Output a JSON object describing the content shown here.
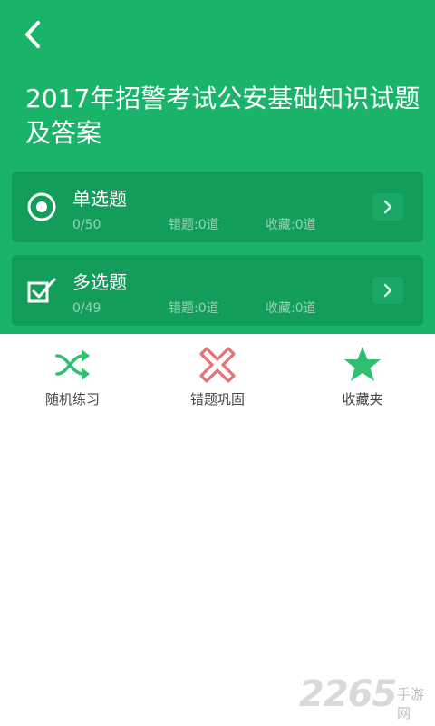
{
  "colors": {
    "header": "#19b36a",
    "card": "#139d5b",
    "accent": "#2fbf71",
    "wrong": "#e57373"
  },
  "header": {
    "title": "2017年招警考试公安基础知识试题及答案",
    "back_icon": "chevron-left-icon"
  },
  "cards": [
    {
      "title": "单选题",
      "progress": "0/50",
      "wrong": "错题:0道",
      "favorites": "收藏:0道",
      "icon": "radio-icon"
    },
    {
      "title": "多选题",
      "progress": "0/49",
      "wrong": "错题:0道",
      "favorites": "收藏:0道",
      "icon": "checkbox-icon"
    }
  ],
  "actions": [
    {
      "label": "随机练习",
      "icon": "shuffle-icon"
    },
    {
      "label": "错题巩固",
      "icon": "cross-icon"
    },
    {
      "label": "收藏夹",
      "icon": "star-icon"
    }
  ],
  "watermark": {
    "number": "2265",
    "text": "手游网"
  }
}
